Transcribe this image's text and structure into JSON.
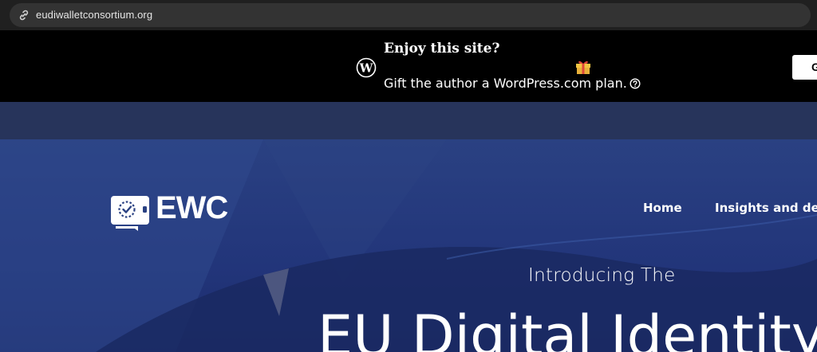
{
  "browser": {
    "url": "eudiwalletconsortium.org",
    "site_info_icon": "link-icon"
  },
  "banner": {
    "logo_icon": "wordpress-logo-icon",
    "title": "Enjoy this site?",
    "subtitle": "Gift the author a WordPress.com plan.",
    "gift_icon": "gift-icon",
    "help_icon": "question-circle-icon",
    "button_label": "G",
    "background": "#000000"
  },
  "site": {
    "logo_text": "EWC",
    "logo_icon": "wallet-check-icon",
    "nav": {
      "home": "Home",
      "insights": "Insights and deliverables"
    }
  },
  "hero": {
    "intro": "Introducing The",
    "title": "EU Digital Identity Wallet",
    "accent": "#22357a"
  }
}
